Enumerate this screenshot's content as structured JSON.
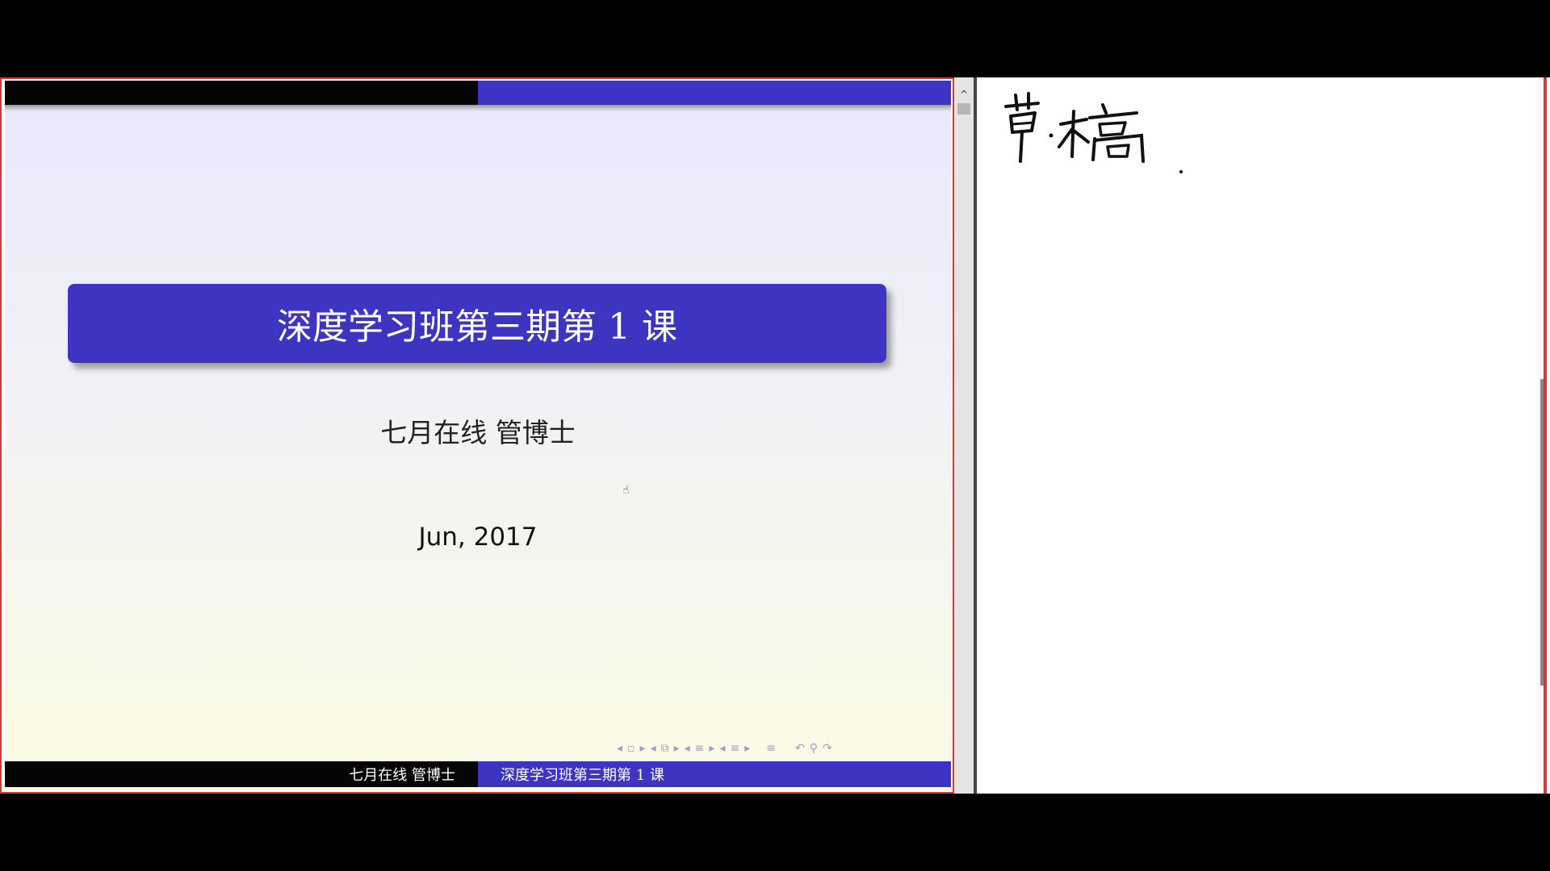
{
  "slide": {
    "title": "深度学习班第三期第 1 课",
    "author": "七月在线 管博士",
    "date": "Jun, 2017",
    "footer_left": "七月在线 管博士",
    "footer_right": "深度学习班第三期第 1 课",
    "nav_symbols": [
      "◂",
      "▫",
      "▸",
      "◂",
      "⧉",
      "▸",
      "◂",
      "≡",
      "▸",
      "◂",
      "≡",
      "▸",
      "≡",
      "↶",
      "⚲",
      "↷"
    ]
  },
  "scrollbar": {
    "up_arrow": "^"
  },
  "notes": {
    "handwriting": "草稿"
  },
  "colors": {
    "accent": "#3d35c2",
    "window_border": "#d23a3a",
    "background": "#000000"
  }
}
